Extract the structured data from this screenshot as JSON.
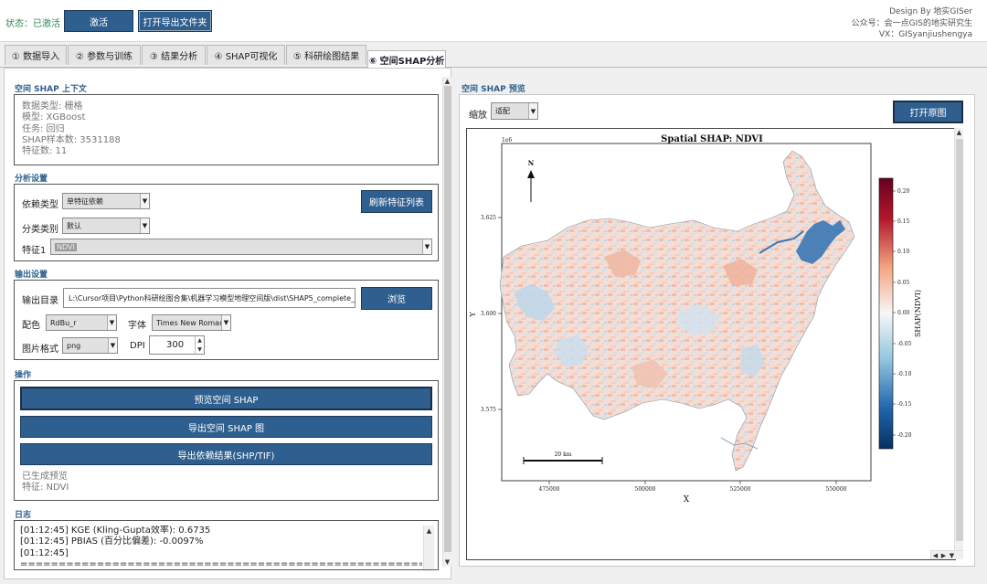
{
  "topbar": {
    "status": "状态：已激活",
    "activate_label": "激活",
    "open_export_label": "打开导出文件夹",
    "credit_lines": [
      "Design By 地实GISer",
      "公众号：会一点GIS的地实研究生",
      "VX：GISyanjiushengya"
    ]
  },
  "tabs": [
    {
      "label": "① 数据导入"
    },
    {
      "label": "② 参数与训练"
    },
    {
      "label": "③ 结果分析"
    },
    {
      "label": "④ SHAP可视化"
    },
    {
      "label": "⑤ 科研绘图结果"
    },
    {
      "label": "⑥ 空间SHAP分析",
      "active": true
    }
  ],
  "context": {
    "title": "空间 SHAP 上下文",
    "lines": [
      "数据类型: 栅格",
      "模型: XGBoost",
      "任务: 回归",
      "SHAP样本数: 3531188",
      "特征数: 11"
    ]
  },
  "analysis": {
    "title": "分析设置",
    "dep_type_label": "依赖类型",
    "dep_type_value": "单特征依赖",
    "refresh_label": "刷新特征列表",
    "class_label": "分类类别",
    "class_value": "默认",
    "feature_label": "特征1",
    "feature_value": "NDVI"
  },
  "output": {
    "title": "输出设置",
    "dir_label": "输出目录",
    "dir_value": "L:\\Cursor项目\\Python科研绘图合集\\机器学习模型地理空间版\\dist\\SHAP5_complete_standa",
    "browse_label": "浏览",
    "cmap_label": "配色",
    "cmap_value": "RdBu_r",
    "font_label": "字体",
    "font_value": "Times New Roman",
    "format_label": "图片格式",
    "format_value": "png",
    "dpi_label": "DPI",
    "dpi_value": "300"
  },
  "operations": {
    "title": "操作",
    "preview_label": "预览空间 SHAP",
    "export_map_label": "导出空间 SHAP 图",
    "export_dep_label": "导出依赖结果(SHP/TIF)",
    "status_lines": [
      "已生成预览",
      "特征: NDVI"
    ]
  },
  "log": {
    "title": "日志",
    "lines": [
      "[01:12:45] KGE (Kling-Gupta效率): 0.6735",
      "[01:12:45] PBIAS (百分比偏差): -0.0097%",
      "[01:12:45]",
      "=============================================================="
    ]
  },
  "preview": {
    "title": "空间 SHAP 预览",
    "zoom_label": "缩放",
    "zoom_value": "适配",
    "open_image_label": "打开原图"
  },
  "figure": {
    "title": "Spatial SHAP: NDVI",
    "y_exponent": "1e6",
    "north_label": "N",
    "scalebar_label": "20 km",
    "xlabel": "X",
    "ylabel": "Y",
    "x_ticks": [
      "475000",
      "500000",
      "525000",
      "550000"
    ],
    "y_ticks": [
      "3.625",
      "3.600",
      "3.575"
    ],
    "colorbar_label": "SHAP(NDVI)",
    "colorbar_ticks": [
      "0.20",
      "0.15",
      "0.10",
      "0.05",
      "0.00",
      "-0.05",
      "-0.10",
      "-0.15",
      "-0.20"
    ],
    "colormap": "RdBu_r",
    "colors": {
      "neg": "#2166ac",
      "zero": "#f7f7f7",
      "pos": "#b2182b"
    }
  }
}
